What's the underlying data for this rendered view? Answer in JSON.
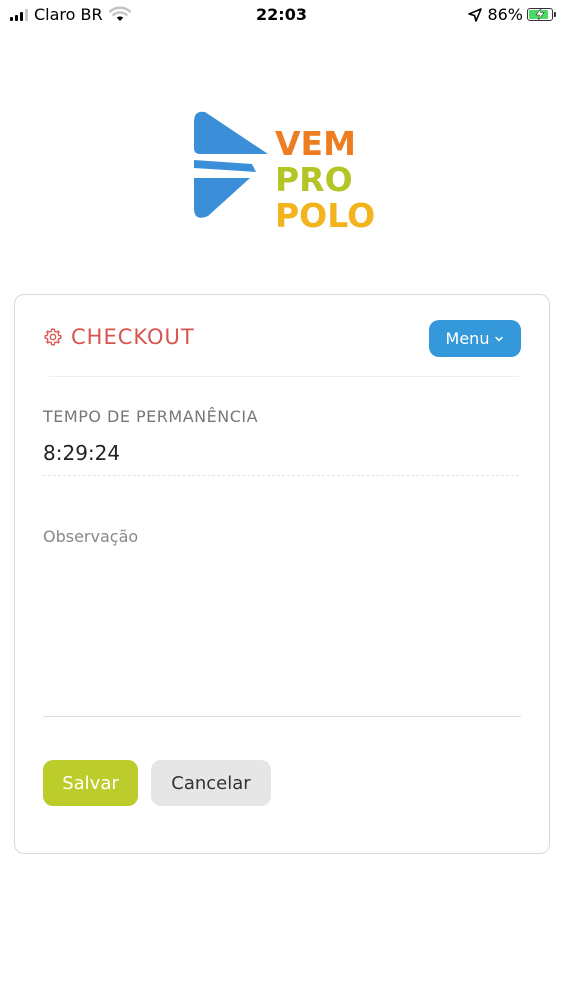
{
  "status_bar": {
    "carrier": "Claro BR",
    "time": "22:03",
    "battery_percent": "86%",
    "battery_level": 0.86,
    "charging": true
  },
  "logo": {
    "lines": [
      "VEM",
      "PRO",
      "POLO"
    ],
    "colors": {
      "mark": "#3a8fd8",
      "vem": "#ee7d22",
      "pro": "#b4c528",
      "polo": "#f2b31d"
    }
  },
  "card": {
    "title": "CHECKOUT",
    "title_color": "#d9534f",
    "menu_label": "Menu",
    "menu_color": "#3498db",
    "tempo": {
      "label": "TEMPO DE PERMANÊNCIA",
      "value": "8:29:24"
    },
    "observacao": {
      "placeholder": "Observação",
      "value": ""
    },
    "save_label": "Salvar",
    "save_color": "#bccd2b",
    "cancel_label": "Cancelar"
  }
}
